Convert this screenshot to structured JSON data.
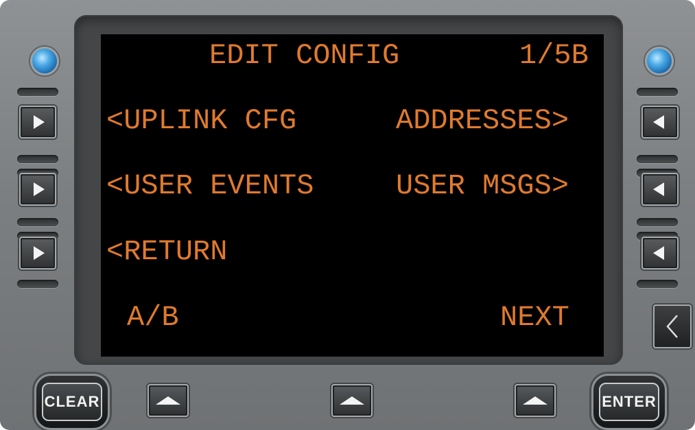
{
  "screen": {
    "title": "EDIT CONFIG",
    "page": "1/5B",
    "text_color": "#e07a2e",
    "rows": {
      "l1": "<UPLINK CFG",
      "r1": "ADDRESSES>",
      "l2": "<USER EVENTS",
      "r2": "USER MSGS>",
      "l3": "<RETURN",
      "bottom_left": "A/B",
      "bottom_right": "NEXT"
    }
  },
  "buttons": {
    "clear": "CLEAR",
    "enter": "ENTER"
  },
  "icons": {
    "line_select_left": "triangle-right-icon",
    "line_select_right": "triangle-left-icon",
    "bottom_keys": "triangle-up-icon",
    "back": "chevron-left-icon",
    "leds": "blue-led-icon"
  }
}
